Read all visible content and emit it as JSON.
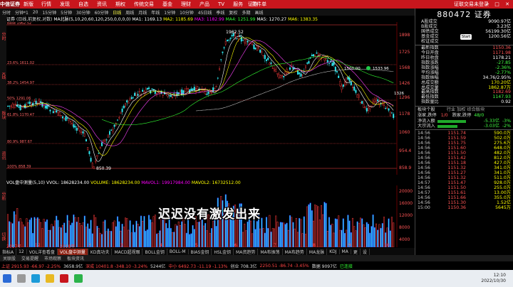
{
  "topbar": {
    "logo": "中信证券",
    "version": "新版",
    "menu": [
      "行情",
      "发现",
      "自选",
      "资讯",
      "期权",
      "传统交易",
      "基金",
      "理财",
      "产品",
      "TV",
      "服务",
      "条件单"
    ],
    "title": "证券",
    "right": "证联交易未登录",
    "winctl": "─ □ ✕"
  },
  "toolbar": {
    "items": [
      "分时",
      "分钟*1",
      "20",
      "15分钟",
      "5分钟",
      "30分钟",
      "60分钟",
      "日线",
      "周线",
      "月线",
      "年线",
      "1分钟",
      "10分钟",
      "45日线",
      "季线",
      "复权",
      "多期",
      "画线"
    ],
    "active": "日线"
  },
  "side_labels": [
    "分时",
    "K线",
    "板块",
    "资讯",
    "分析",
    "切换"
  ],
  "info": {
    "name": "证券",
    "type": "(日线,前复权,对数)",
    "ma_label": "MA北脉(5,10,20,60,120,250,0,0,0,0)",
    "ma1": "MA1: 1169.13",
    "ma2": "MA2: 1185.69",
    "ma3": "MA3: 1182.99",
    "ma4": "MA4: 1251.99",
    "ma5": "MA5: 1270.27",
    "ma6": "MA6: 1383.35"
  },
  "chart_data": {
    "type": "candlestick",
    "y_axis_ticks": [
      "1898",
      "1725",
      "1568",
      "1426",
      "1296",
      "1178",
      "1060",
      "954.4",
      "858.9"
    ],
    "fib_labels": [
      "base 1962.52",
      "23.6% 1611.02",
      "38.2% 1454.97",
      "50% 1291.06",
      "61.8% 1170.47",
      "80.9% 987.67",
      "100% 858.39"
    ],
    "annotations": {
      "high": "1962.52",
      "low": "850.39",
      "mid": "1500.00",
      "circle": "1533.96",
      "right": "1326"
    },
    "x_axis_labels": [
      "2017年",
      "12",
      "2018年",
      "2",
      "3",
      "4",
      "5",
      "6",
      "7",
      "8",
      "9",
      "10"
    ]
  },
  "volume": {
    "title": "VOL盘中测量(5,10)",
    "vvol": "VVOL: 18628234.00",
    "volume": "VOLUME: 18628234.00",
    "mavol1": "MAVOL1: 19917984.00",
    "mavol2": "MAVOL2: 16732512.00",
    "y_ticks": [
      "20000",
      "16000",
      "12000",
      "8000",
      "4000"
    ]
  },
  "overlay_text": "迟迟没有激发出来",
  "indicators": {
    "items": [
      "指标A",
      "12",
      "VOL洋查看盘",
      "VOL盘中测量",
      "KD真功夫",
      "MACD超视眼",
      "BOLL金钥",
      "BOLL-M",
      "BIAS金钥",
      "HSL金钥",
      "MA资趋势",
      "MA布振荡",
      "MA布趋势",
      "MA龙脉",
      "KDJ",
      "MA",
      "更",
      "设"
    ],
    "active": "VOL盘中测量"
  },
  "bottom_tabs": [
    "关联股",
    "交易提醒",
    "市场观察",
    "板块资讯"
  ],
  "status": {
    "s1": "上证 2915.93 -66.97 -2.25%",
    "s2": "3658.9亿",
    "s3": "深成 10401.8 -348.10 -3.24%",
    "s4": "5244亿",
    "s5": "中小 6492.73 -11.19 -1.13%",
    "s6": "创业 708.3亿",
    "s7": "2250.51 -86.74 -3.45%",
    "s8": "数据 9097亿",
    "s9": "已连接"
  },
  "clock": {
    "time": "12:10",
    "date": "2022/10/30"
  },
  "right_panel": {
    "header": "880472 证券",
    "start": "Start",
    "rows1": [
      {
        "label": "A股成交",
        "value": "9090.97亿"
      },
      {
        "label": "B股成交",
        "value": "3.23亿"
      },
      {
        "label": "国债成交",
        "value": "56199.30亿"
      },
      {
        "label": "基金成交",
        "value": "1200.56亿"
      },
      {
        "label": "权证成交",
        "value": ""
      }
    ],
    "rows2": [
      {
        "label": "最新指数",
        "value": "1150.36",
        "cls": "red"
      },
      {
        "label": "今日开盘",
        "value": "1171.98",
        "cls": "red"
      },
      {
        "label": "昨日收盘",
        "value": "1178.21",
        "cls": "val"
      },
      {
        "label": "指数涨跌",
        "value": "-27.85",
        "cls": "grn"
      },
      {
        "label": "指数涨幅",
        "value": "-2.36%",
        "cls": "grn"
      },
      {
        "label": "平均涨幅",
        "value": "-2.77%",
        "cls": "grn"
      },
      {
        "label": "指数振幅",
        "value": "34.76/2.95%",
        "cls": "val"
      },
      {
        "label": "总成交额",
        "value": "170.20亿",
        "cls": "yel"
      },
      {
        "label": "总成交量",
        "value": "1862.87万",
        "cls": "yel"
      },
      {
        "label": "最高指数",
        "value": "1182.69",
        "cls": "red"
      },
      {
        "label": "最低指数",
        "value": "1147.93",
        "cls": "grn"
      },
      {
        "label": "指数量比",
        "value": "0.92",
        "cls": "val"
      }
    ],
    "tabs": [
      "板块个股",
      "行业 加权 综合版块"
    ],
    "counts": {
      "label": "涨家,跌停",
      "a": "1/0",
      "b": "跌家,跌停",
      "c": "48/0"
    },
    "flow": [
      {
        "label": "净流入额",
        "value": "-5.33亿",
        "pct": "-3%"
      },
      {
        "label": "大宗流入",
        "value": "-3.03亿",
        "pct": "-2%"
      }
    ],
    "ticks": [
      {
        "t": "14:56",
        "p": "1151.74",
        "v": "590.0万"
      },
      {
        "t": "14:56",
        "p": "1151.59",
        "v": "502.0万"
      },
      {
        "t": "14:56",
        "p": "1151.75",
        "v": "275.6万"
      },
      {
        "t": "14:56",
        "p": "1151.60",
        "v": "648.0万"
      },
      {
        "t": "14:56",
        "p": "1151.50",
        "v": "482.0万"
      },
      {
        "t": "14:56",
        "p": "1151.42",
        "v": "812.0万"
      },
      {
        "t": "14:56",
        "p": "1151.18",
        "v": "427.0万"
      },
      {
        "t": "14:56",
        "p": "1151.32",
        "v": "341.0万"
      },
      {
        "t": "14:56",
        "p": "1151.27",
        "v": "341.0万"
      },
      {
        "t": "14:56",
        "p": "1151.32",
        "v": "511.0万"
      },
      {
        "t": "14:57",
        "p": "1151.47",
        "v": "928.0万"
      },
      {
        "t": "14:56",
        "p": "1151.50",
        "v": "255.0万"
      },
      {
        "t": "14:57",
        "p": "1151.61",
        "v": "13.00万"
      },
      {
        "t": "14:56",
        "p": "1151.66",
        "v": "355.0万"
      },
      {
        "t": "14:56",
        "p": "1151.30",
        "v": "1.52亿"
      },
      {
        "t": "15:00",
        "p": "1150.36",
        "v": "5645万"
      }
    ]
  }
}
